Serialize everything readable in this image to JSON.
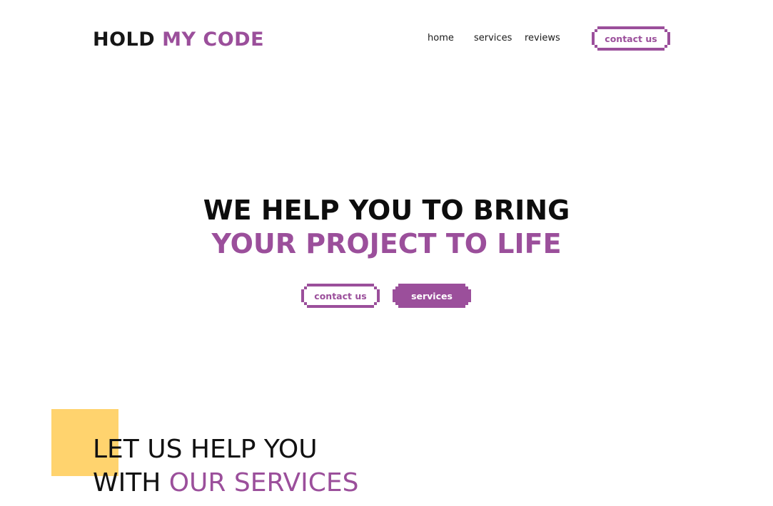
{
  "header": {
    "logo": {
      "part1": "HOLD",
      "part2": "MY CODE"
    },
    "nav": [
      {
        "label": "home"
      },
      {
        "label": "services"
      },
      {
        "label": "reviews"
      }
    ],
    "contact_button": "contact us"
  },
  "hero": {
    "line1": "WE HELP YOU TO BRING",
    "line2": "YOUR PROJECT TO LIFE",
    "contact_button": "contact us",
    "services_button": "services"
  },
  "services_section": {
    "line1": "LET US HELP YOU",
    "line2_plain": "WITH ",
    "line2_accent": "OUR SERVICES"
  },
  "colors": {
    "accent": "#9b4f9b",
    "dark": "#161616",
    "yellow": "#ffd36e",
    "background": "#ffffff"
  }
}
